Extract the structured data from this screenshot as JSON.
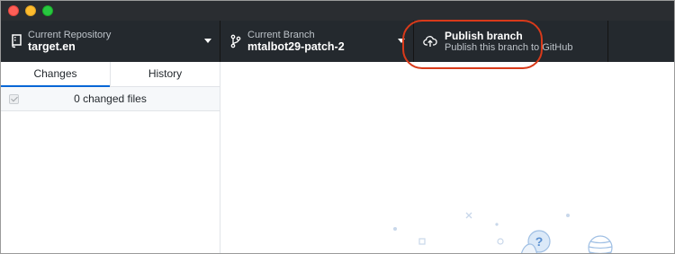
{
  "window": {
    "traffic_lights": [
      "close",
      "minimize",
      "zoom"
    ]
  },
  "toolbar": {
    "repository": {
      "title": "Current Repository",
      "value": "target.en",
      "icon": "repo-icon"
    },
    "branch": {
      "title": "Current Branch",
      "value": "mtalbot29-patch-2",
      "icon": "git-branch-icon"
    },
    "publish": {
      "title": "Publish branch",
      "subtitle": "Publish this branch to GitHub",
      "icon": "cloud-upload-icon"
    }
  },
  "sidebar": {
    "tabs": [
      {
        "label": "Changes",
        "active": true
      },
      {
        "label": "History",
        "active": false
      }
    ],
    "changes_summary": "0 changed files"
  },
  "colors": {
    "toolbar_bg": "#24292e",
    "accent_blue": "#0366d6",
    "highlight_red": "#d93a1a"
  }
}
